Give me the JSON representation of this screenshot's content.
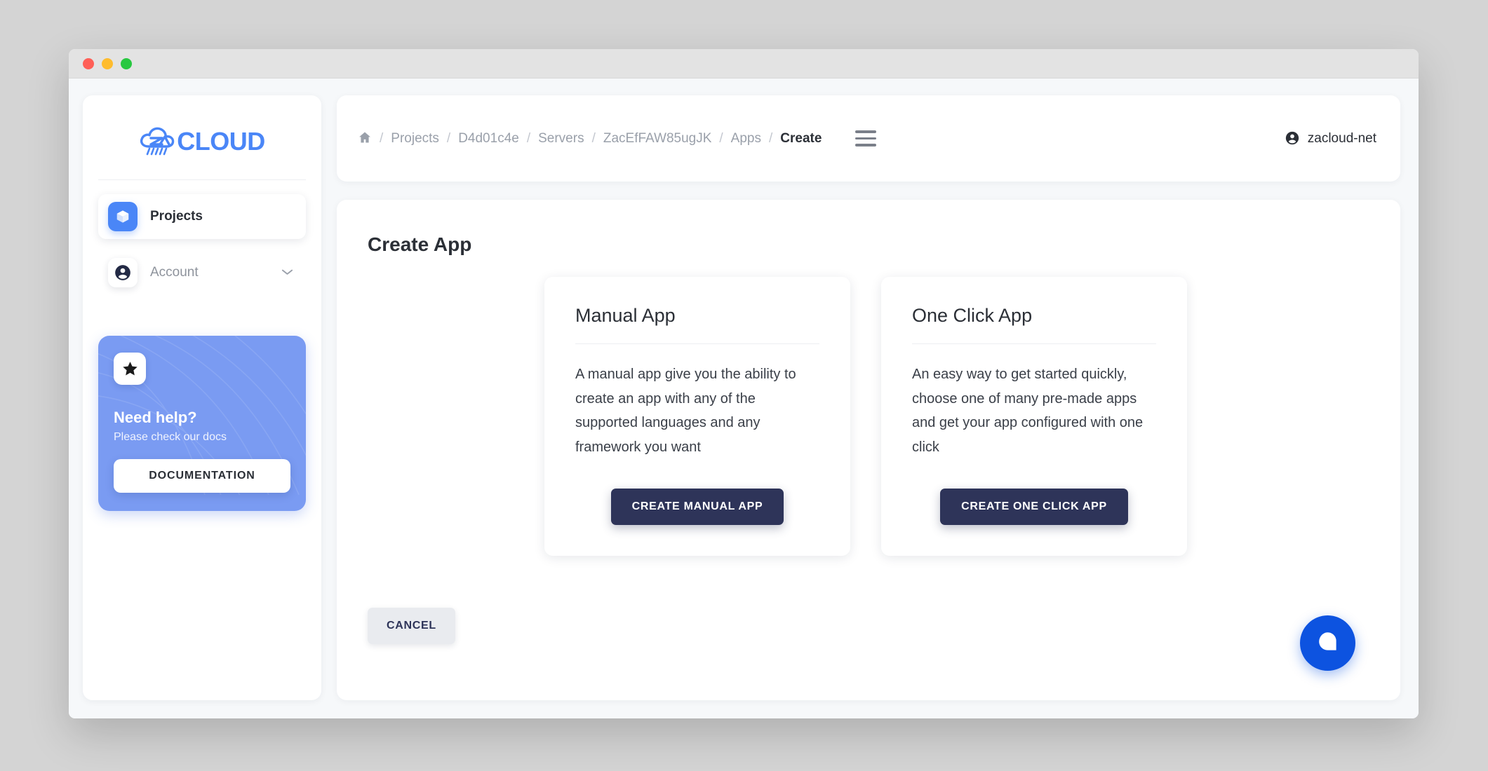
{
  "window": {
    "traffic_lights": [
      {
        "name": "close",
        "color": "#ff5f57"
      },
      {
        "name": "minimize",
        "color": "#febc2e"
      },
      {
        "name": "maximize",
        "color": "#28c840"
      }
    ]
  },
  "sidebar": {
    "logo": {
      "icon": "za-cloud-logo-icon",
      "text": "CLOUD",
      "color": "#4a86f7"
    },
    "items": [
      {
        "label": "Projects",
        "icon": "cube-icon",
        "active": true
      },
      {
        "label": "Account",
        "icon": "person-circle-icon",
        "active": false,
        "expandable": true
      }
    ],
    "help_card": {
      "icon": "star-icon",
      "title": "Need help?",
      "subtitle": "Please check our docs",
      "button_label": "DOCUMENTATION",
      "background_color": "#7a9bf2"
    }
  },
  "topbar": {
    "breadcrumb": [
      {
        "label": "",
        "icon": "home-icon",
        "current": false
      },
      {
        "label": "Projects",
        "current": false
      },
      {
        "label": "D4d01c4e",
        "current": false
      },
      {
        "label": "Servers",
        "current": false
      },
      {
        "label": "ZacEfFAW85ugJK",
        "current": false
      },
      {
        "label": "Apps",
        "current": false
      },
      {
        "label": "Create",
        "current": true
      }
    ],
    "separator": "/",
    "menu_icon": "hamburger-menu-icon",
    "user": {
      "name": "zacloud-net",
      "icon": "account-circle-icon"
    }
  },
  "main": {
    "page_title": "Create App",
    "cards": [
      {
        "title": "Manual App",
        "description": "A manual app give you the ability to create an app with any of the supported languages and any framework you want",
        "button_label": "CREATE MANUAL APP"
      },
      {
        "title": "One Click App",
        "description": "An easy way to get started quickly, choose one of many pre-made apps and get your app configured with one click",
        "button_label": "CREATE ONE CLICK APP"
      }
    ],
    "cancel_label": "CANCEL",
    "button_color": "#2e3459"
  },
  "chat_widget": {
    "icon": "chat-bubble-icon",
    "color": "#0d53e0"
  }
}
